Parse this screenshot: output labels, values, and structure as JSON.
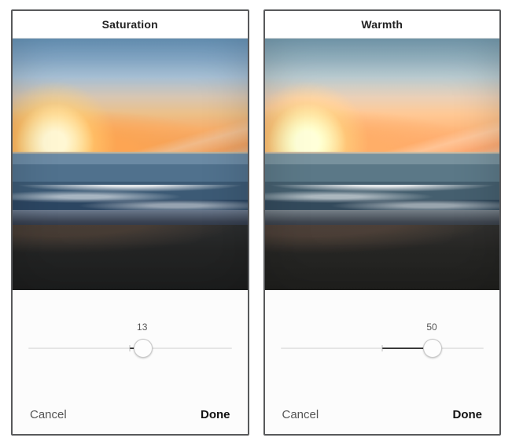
{
  "panels": [
    {
      "id": "saturation",
      "title": "Saturation",
      "slider": {
        "min": -100,
        "max": 100,
        "value": 13,
        "value_label": "13"
      },
      "footer": {
        "cancel": "Cancel",
        "done": "Done"
      }
    },
    {
      "id": "warmth",
      "title": "Warmth",
      "slider": {
        "min": -100,
        "max": 100,
        "value": 50,
        "value_label": "50"
      },
      "footer": {
        "cancel": "Cancel",
        "done": "Done"
      }
    }
  ]
}
